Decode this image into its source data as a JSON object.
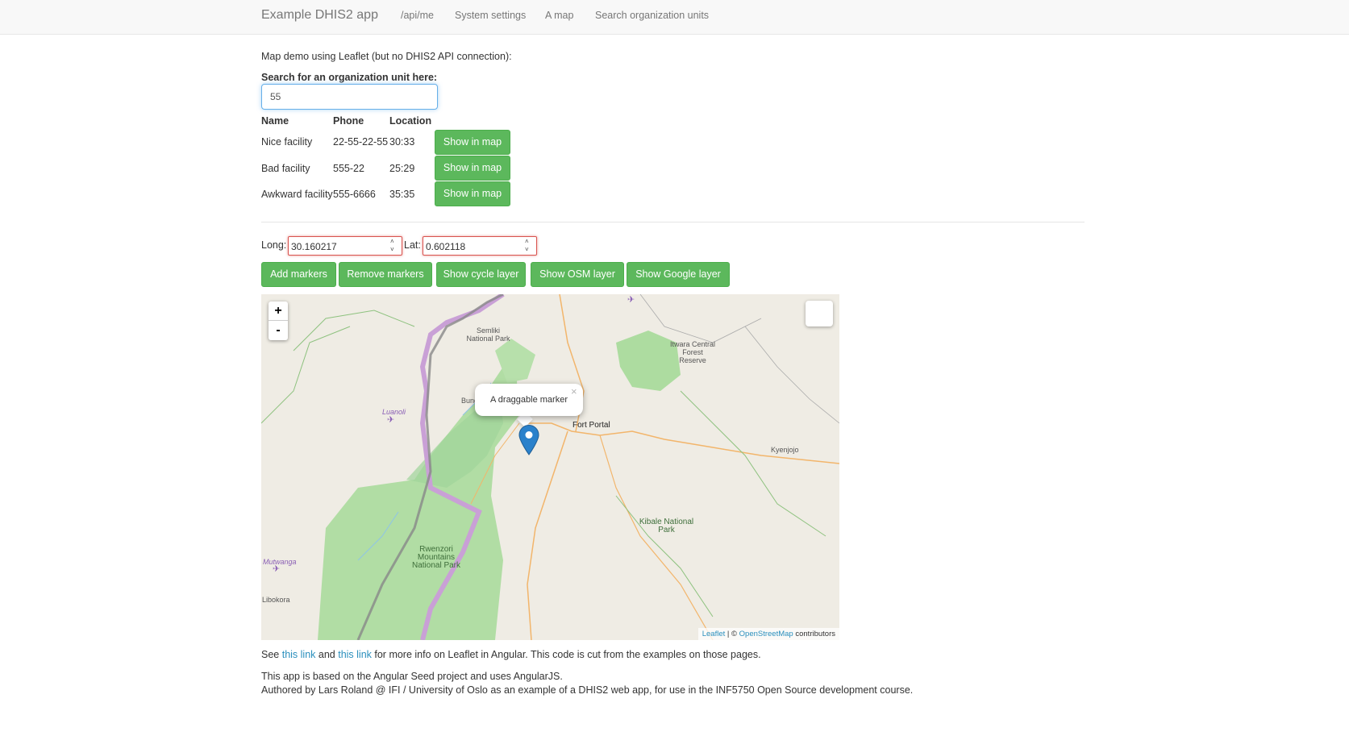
{
  "navbar": {
    "brand": "Example DHIS2 app",
    "links": [
      "/api/me",
      "System settings",
      "A map",
      "Search organization units"
    ]
  },
  "intro": "Map demo using Leaflet (but no DHIS2 API connection):",
  "search": {
    "label": "Search for an organization unit here:",
    "value": "55"
  },
  "table": {
    "headers": [
      "Name",
      "Phone",
      "Location"
    ],
    "rows": [
      {
        "name": "Nice facility",
        "phone": "22-55-22-55",
        "location": "30:33",
        "button": "Show in map"
      },
      {
        "name": "Bad facility",
        "phone": "555-22",
        "location": "25:29",
        "button": "Show in map"
      },
      {
        "name": "Awkward facility",
        "phone": "555-6666",
        "location": "35:35",
        "button": "Show in map"
      }
    ]
  },
  "coords": {
    "long_label": "Long:",
    "long_value": "30.160217",
    "lat_label": "Lat:",
    "lat_value": "0.602118"
  },
  "map_buttons": [
    "Add markers",
    "Remove markers",
    "Show cycle layer",
    "Show OSM layer",
    "Show Google layer"
  ],
  "map": {
    "zoom_in": "+",
    "zoom_out": "-",
    "popup_text": "A draggable marker",
    "popup_close": "×",
    "labels": {
      "semliki": "Semliki National Park",
      "itwara": "Itwara Central Forest Reserve",
      "fort_portal": "Fort Portal",
      "kyenjojo": "Kyenjojo",
      "kibale": "Kibale National Park",
      "rwenzori": "Rwenzori Mountains National Park",
      "luanoli": "Luanoli",
      "bundi": "Bund",
      "mutwanga": "Mutwanga",
      "libokora": "Libokora"
    },
    "attribution": {
      "leaflet": "Leaflet",
      "sep": " | © ",
      "osm": "OpenStreetMap",
      "contributors": " contributors"
    }
  },
  "footer": {
    "see": "See ",
    "link1": "this link",
    "and": " and ",
    "link2": "this link",
    "rest": " for more info on Leaflet in Angular. This code is cut from the examples on those pages.",
    "line2": "This app is based on the Angular Seed project and uses AngularJS.",
    "line3": "Authored by Lars Roland @ IFI / University of Oslo as an example of a DHIS2 web app, for use in the INF5750 Open Source development course."
  }
}
